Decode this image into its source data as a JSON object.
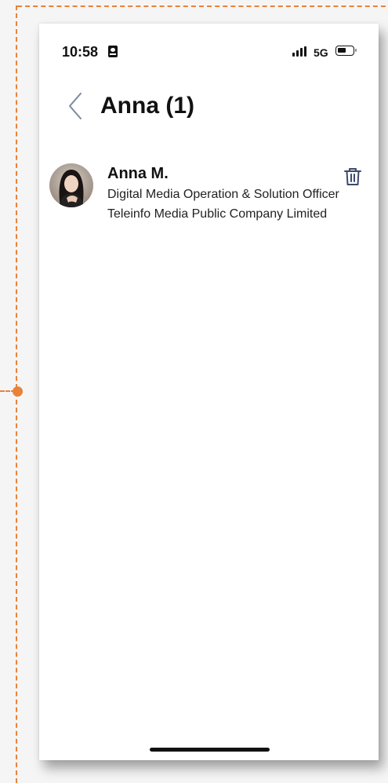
{
  "status_bar": {
    "time": "10:58",
    "network": "5G",
    "icons": [
      "id-badge-icon",
      "signal-icon",
      "battery-icon"
    ]
  },
  "header": {
    "back_icon": "chevron-left-icon",
    "title": "Anna (1)"
  },
  "contacts": [
    {
      "name": "Anna M.",
      "title": "Digital Media Operation & Solution Officer",
      "company": "Teleinfo Media Public Company Limited",
      "avatar": "profile-photo",
      "action_icon": "trash-icon"
    }
  ],
  "colors": {
    "annotation_frame": "#e8823a",
    "back_chevron": "#7a8aa0",
    "trash_icon": "#3d4a6a",
    "text": "#111111"
  }
}
